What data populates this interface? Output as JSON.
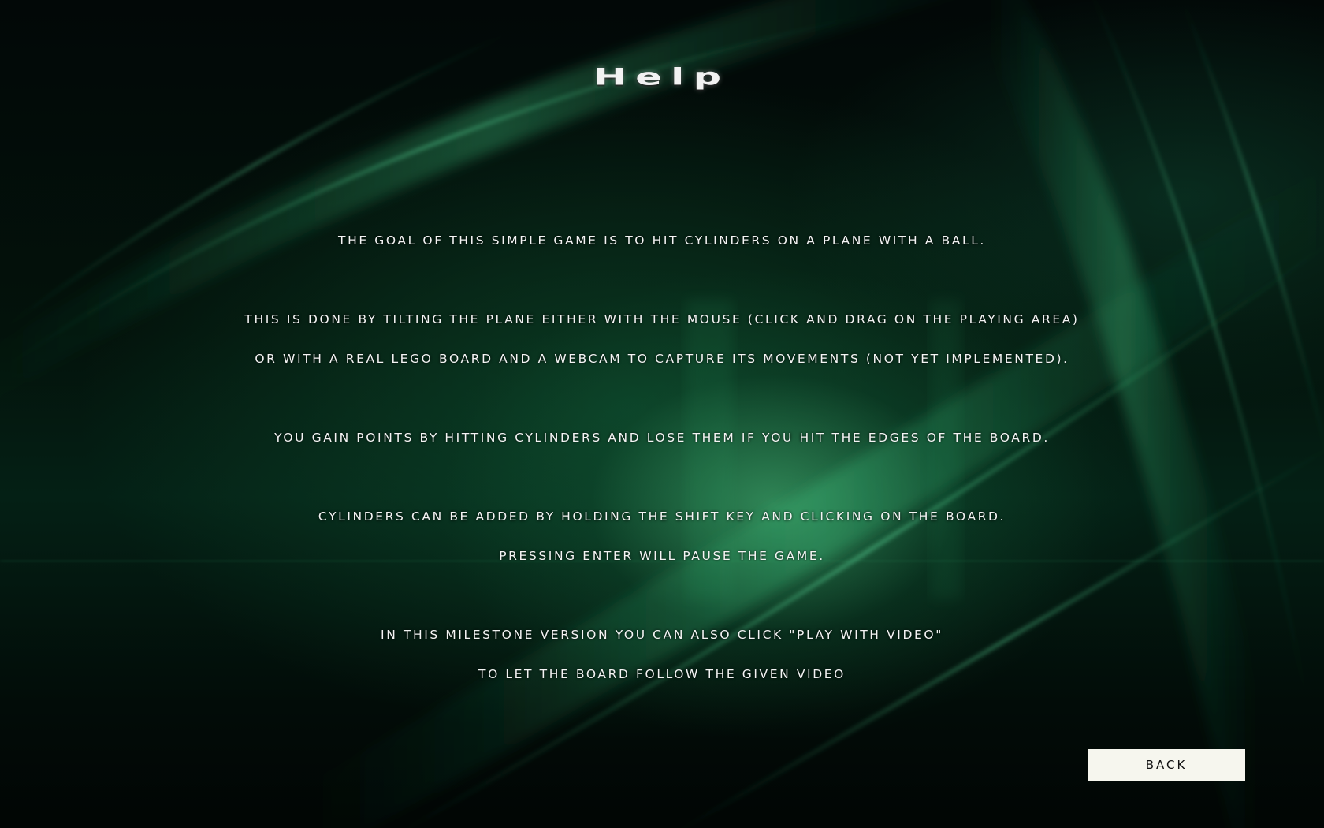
{
  "page": {
    "title": "Help"
  },
  "help_text": {
    "line1": "The goal of this simple game is to hit cylinders on a plane with a ball.",
    "line2": "This is done by tilting the plane either with the mouse (click and drag on the playing area)",
    "line3": "or with a real Lego board and a webcam to capture its movements (not yet implemented).",
    "line4": "You gain points by hitting cylinders and lose them if you hit the edges of the board.",
    "line5": "Cylinders can be added by holding the Shift key and clicking on the board.",
    "line6": "Pressing Enter will pause the game.",
    "line7": "In this milestone version you can also click \"Play with video\"",
    "line8": "to let the board follow the given video"
  },
  "buttons": {
    "back_label": "Back"
  },
  "colors": {
    "background": "#020806",
    "accent_glow": "#3fc27a",
    "text": "#f4f4f4",
    "button_bg": "#f6f6ee",
    "button_text": "#111111"
  }
}
